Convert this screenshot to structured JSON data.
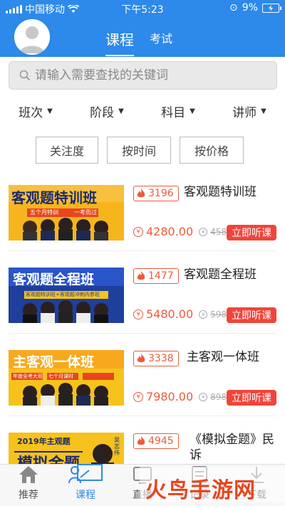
{
  "status_bar": {
    "carrier": "中国移动",
    "time": "下午5:23",
    "battery": "9%"
  },
  "header": {
    "tabs": [
      {
        "label": "课程",
        "active": true
      },
      {
        "label": "考试",
        "active": false
      }
    ]
  },
  "search": {
    "placeholder": "请输入需要查找的关键词"
  },
  "filters": [
    "班次",
    "阶段",
    "科目",
    "讲师"
  ],
  "sort_buttons": [
    "关注度",
    "按时间",
    "按价格"
  ],
  "courses": [
    {
      "thumb_text": "客观题特训班",
      "thumb_sub": "五个月特训",
      "thumb_sub2": "一考而过",
      "hot": "3196",
      "title": "客观题特训班",
      "price": "4280.00",
      "old_price": "4580",
      "action": "立即听课",
      "thumb_bg": "#f6b51c",
      "thumb_band": "#e8461f"
    },
    {
      "thumb_text": "客观题全程班",
      "thumb_sub": "客观题特训班+客观题冲刺内参班",
      "thumb_sub2": "",
      "hot": "1477",
      "title": "客观题全程班",
      "price": "5480.00",
      "old_price": "5980",
      "action": "立即听课",
      "thumb_bg": "#1f3f9c",
      "thumb_band": "#f6c21c"
    },
    {
      "thumb_text": "主客观一体班",
      "thumb_sub": "年度全考大班",
      "thumb_sub2": "七个月课时",
      "hot": "3338",
      "title": "主客观一体班",
      "price": "7980.00",
      "old_price": "8980",
      "action": "立即听课",
      "thumb_bg": "#f6c21c",
      "thumb_band": "#e8461f"
    },
    {
      "thumb_text": "模拟金题",
      "thumb_sub": "2019年主观题",
      "thumb_sub2": "吴志伟",
      "hot": "4945",
      "title": "《模拟金题》民诉",
      "price": "",
      "old_price": "",
      "action": "",
      "thumb_bg": "#f6c21c",
      "thumb_band": "#ffffff"
    }
  ],
  "tabbar": [
    {
      "label": "推荐",
      "icon": "home-icon",
      "active": false
    },
    {
      "label": "课程",
      "icon": "course-icon",
      "active": true
    },
    {
      "label": "直播",
      "icon": "live-icon",
      "active": false
    },
    {
      "label": "记录",
      "icon": "record-icon",
      "active": false
    },
    {
      "label": "下载",
      "icon": "download-icon",
      "active": false
    }
  ],
  "watermark": {
    "text": "火鸟手游网"
  },
  "colors": {
    "primary": "#2d89ea",
    "accent": "#f05a3c",
    "button_red": "#f0453a"
  }
}
